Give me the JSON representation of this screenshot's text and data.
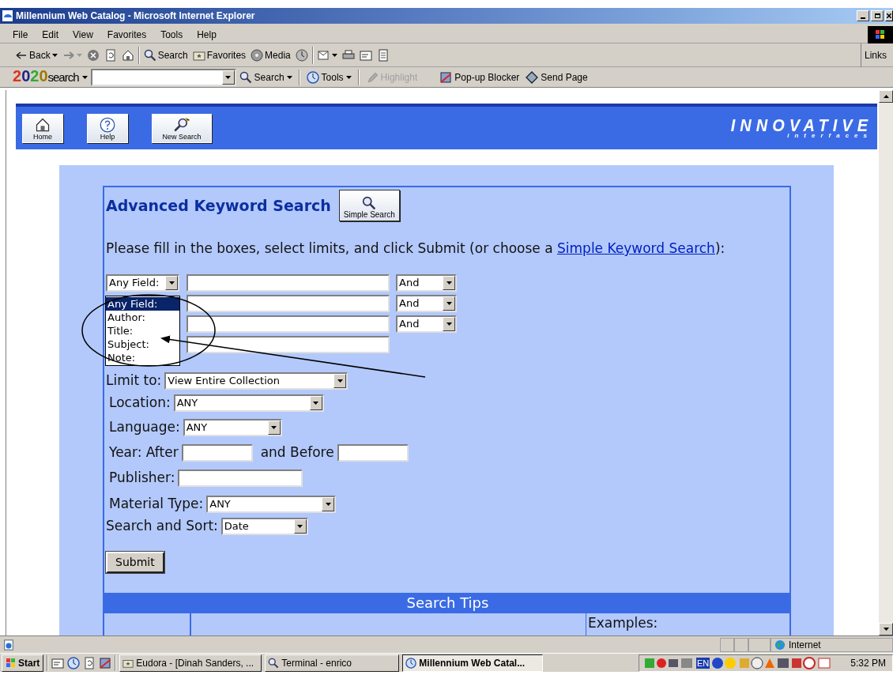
{
  "window": {
    "title": "Millennium Web Catalog - Microsoft Internet Explorer"
  },
  "menu_bar": [
    "File",
    "Edit",
    "View",
    "Favorites",
    "Tools",
    "Help"
  ],
  "toolbar": [
    {
      "kind": "back",
      "label": "Back",
      "has_menu": true
    },
    {
      "kind": "forward",
      "has_menu": true
    },
    {
      "kind": "stop",
      "has_menu": false
    },
    {
      "kind": "refresh",
      "has_menu": false
    },
    {
      "kind": "home",
      "has_menu": false
    },
    {
      "kind": "search",
      "label": "Search",
      "has_menu": false
    },
    {
      "kind": "favorites",
      "label": "Favorites",
      "has_menu": false
    },
    {
      "kind": "media",
      "label": "Media",
      "has_menu": false
    },
    {
      "kind": "history",
      "has_menu": false
    },
    {
      "kind": "mail",
      "has_menu": true
    },
    {
      "kind": "print",
      "has_menu": false
    },
    {
      "kind": "edit",
      "has_menu": false
    },
    {
      "kind": "discuss",
      "has_menu": false
    }
  ],
  "links": "Links",
  "search_bar": {
    "logo_digits": "2020",
    "logo_word": "search",
    "items": [
      {
        "kind": "search",
        "label": "Search",
        "has_menu": true,
        "disabled": false
      },
      {
        "kind": "tools",
        "label": "Tools",
        "has_menu": true,
        "disabled": false
      },
      {
        "kind": "highlight",
        "label": "Highlight",
        "has_menu": false,
        "disabled": true
      },
      {
        "kind": "popup",
        "label": "Pop-up Blocker",
        "has_menu": false,
        "disabled": false
      },
      {
        "kind": "send",
        "label": "Send Page",
        "has_menu": false,
        "disabled": false
      }
    ]
  },
  "header": {
    "buttons": [
      {
        "kind": "home",
        "label": "Home"
      },
      {
        "kind": "help",
        "label": "Help"
      },
      {
        "kind": "new_search",
        "label": "New Search"
      }
    ],
    "logo": "INNOVATIVE",
    "logo_sub": "interfaces"
  },
  "form": {
    "title": "Advanced Keyword Search",
    "simple_search_button": "Simple Search",
    "instructions": "Please fill in the boxes, select limits, and click Submit (or choose a ",
    "instructions_link": "Simple Keyword Search",
    "instructions_end": "):",
    "keyword_rows": [
      {
        "field": "Any Field:",
        "operator": "And"
      },
      {
        "operator": "And"
      },
      {
        "operator": "And"
      },
      {}
    ],
    "field_dropdown": {
      "options": [
        {
          "label": "Any Field:",
          "selected": true
        },
        {
          "label": "Author:",
          "selected": false
        },
        {
          "label": "Title:",
          "selected": false
        },
        {
          "label": "Subject:",
          "selected": false
        },
        {
          "label": "Note:",
          "selected": false
        }
      ]
    },
    "limits": [
      {
        "kind": "select",
        "label": "Limit to:",
        "value": "View Entire Collection"
      },
      {
        "kind": "select",
        "label": "Location:",
        "value": "ANY"
      },
      {
        "kind": "select",
        "label": "Language:",
        "value": "ANY"
      },
      {
        "kind": "range",
        "label": "Year: After",
        "label_2": "and Before"
      },
      {
        "kind": "text",
        "label": "Publisher:"
      },
      {
        "kind": "select",
        "label": "Material Type:",
        "value": "ANY"
      },
      {
        "kind": "select",
        "label": "Search and Sort:",
        "value": "Date"
      }
    ],
    "submit": "Submit",
    "search_tips": {
      "title": "Search Tips",
      "column_3": "Examples:"
    }
  },
  "status_bar": {
    "zone": "Internet"
  },
  "taskbar": {
    "start": "Start",
    "tasks": [
      {
        "label": "Eudora - [Dinah Sanders, ...",
        "selected": false
      },
      {
        "label": "Terminal - enrico",
        "selected": false
      },
      {
        "label": "Millennium Web Catal...",
        "selected": true
      }
    ],
    "language": "EN",
    "clock": "5:32 PM"
  }
}
